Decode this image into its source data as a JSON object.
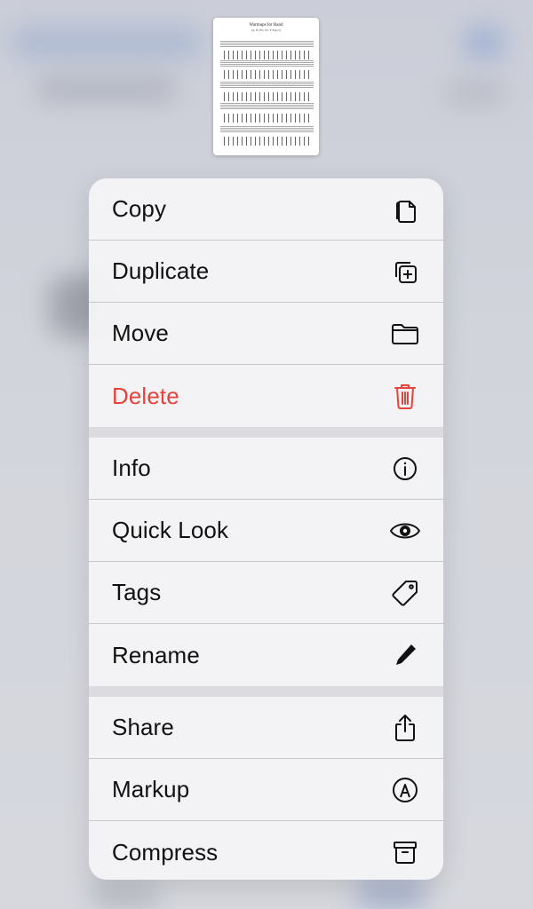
{
  "preview": {
    "title": "Warmups for Band",
    "subtitle": "(A, B, Bb, Eb, F Major)"
  },
  "menu": {
    "groups": [
      [
        {
          "label": "Copy",
          "icon": "copy-icon"
        },
        {
          "label": "Duplicate",
          "icon": "duplicate-icon"
        },
        {
          "label": "Move",
          "icon": "folder-icon"
        },
        {
          "label": "Delete",
          "icon": "trash-icon",
          "destructive": true
        }
      ],
      [
        {
          "label": "Info",
          "icon": "info-icon"
        },
        {
          "label": "Quick Look",
          "icon": "eye-icon"
        },
        {
          "label": "Tags",
          "icon": "tag-icon"
        },
        {
          "label": "Rename",
          "icon": "pencil-icon"
        }
      ],
      [
        {
          "label": "Share",
          "icon": "share-icon"
        },
        {
          "label": "Markup",
          "icon": "markup-icon"
        },
        {
          "label": "Compress",
          "icon": "archive-icon"
        }
      ]
    ]
  },
  "colors": {
    "destructive": "#e5443b",
    "menu_bg": "#f4f4f6",
    "separator": "#dcdce0"
  }
}
